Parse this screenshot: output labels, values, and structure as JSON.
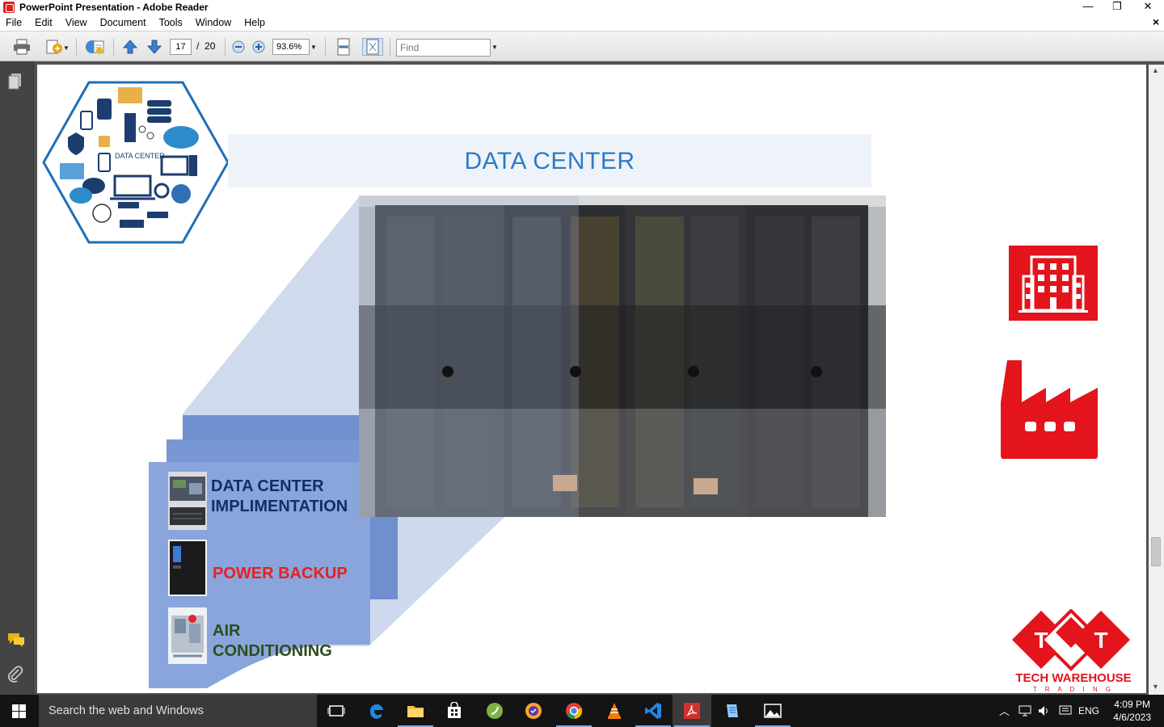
{
  "window": {
    "title": "PowerPoint Presentation - Adobe Reader",
    "controls": {
      "minimize": "—",
      "restore": "❐",
      "close": "✕"
    }
  },
  "menu": {
    "items": [
      "File",
      "Edit",
      "View",
      "Document",
      "Tools",
      "Window",
      "Help"
    ],
    "close_doc": "×"
  },
  "toolbar": {
    "current_page": "17",
    "page_separator": "/",
    "total_pages": "20",
    "zoom": "93.6%",
    "find_placeholder": "Find"
  },
  "slide": {
    "title": "DATA CENTER",
    "hex_logo_text": "DATA CENTER",
    "services": [
      {
        "label_line1": "DATA CENTER",
        "label_line2": "IMPLIMENTATION",
        "color": "#0f2f6b"
      },
      {
        "label_line1": "POWER BACKUP",
        "label_line2": "",
        "color": "#e8201f"
      },
      {
        "label_line1": "AIR",
        "label_line2": "CONDITIONING",
        "color": "#2f4d1c"
      }
    ],
    "brand": {
      "letter": "T",
      "name": "TECH WAREHOUSE",
      "sub": "T R A D I N G",
      "color": "#e3141b"
    },
    "icon_color": "#e3141b"
  },
  "taskbar": {
    "search_placeholder": "Search the web and Windows",
    "language": "ENG",
    "time": "4:09 PM",
    "date": "4/6/2023"
  }
}
